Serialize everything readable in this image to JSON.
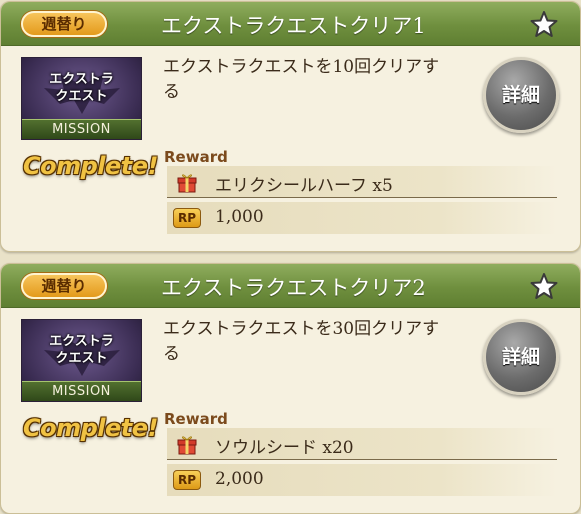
{
  "missions": [
    {
      "badge": "週替り",
      "title": "エクストラクエストクリア1",
      "thumbnail": {
        "line1": "エクストラ",
        "line2": "クエスト",
        "strip": "MISSION"
      },
      "description": "エクストラクエストを10回クリアする",
      "detail_label": "詳細",
      "status": "Complete!",
      "reward_label": "Reward",
      "reward_item": "エリクシールハーフ x5",
      "rp_icon": "RP",
      "rp_value": "1,000"
    },
    {
      "badge": "週替り",
      "title": "エクストラクエストクリア2",
      "thumbnail": {
        "line1": "エクストラ",
        "line2": "クエスト",
        "strip": "MISSION"
      },
      "description": "エクストラクエストを30回クリアする",
      "detail_label": "詳細",
      "status": "Complete!",
      "reward_label": "Reward",
      "reward_item": "ソウルシード x20",
      "rp_icon": "RP",
      "rp_value": "2,000"
    }
  ],
  "icons": {
    "favorite": "star-outline-icon",
    "reward": "gift-icon",
    "thumbnail": "bat-emblem-icon"
  },
  "colors": {
    "header_green": "#6f8f3e",
    "badge_orange": "#e39a1c",
    "complete_gold": "#f0c243",
    "card_bg": "#f6f1e0"
  }
}
